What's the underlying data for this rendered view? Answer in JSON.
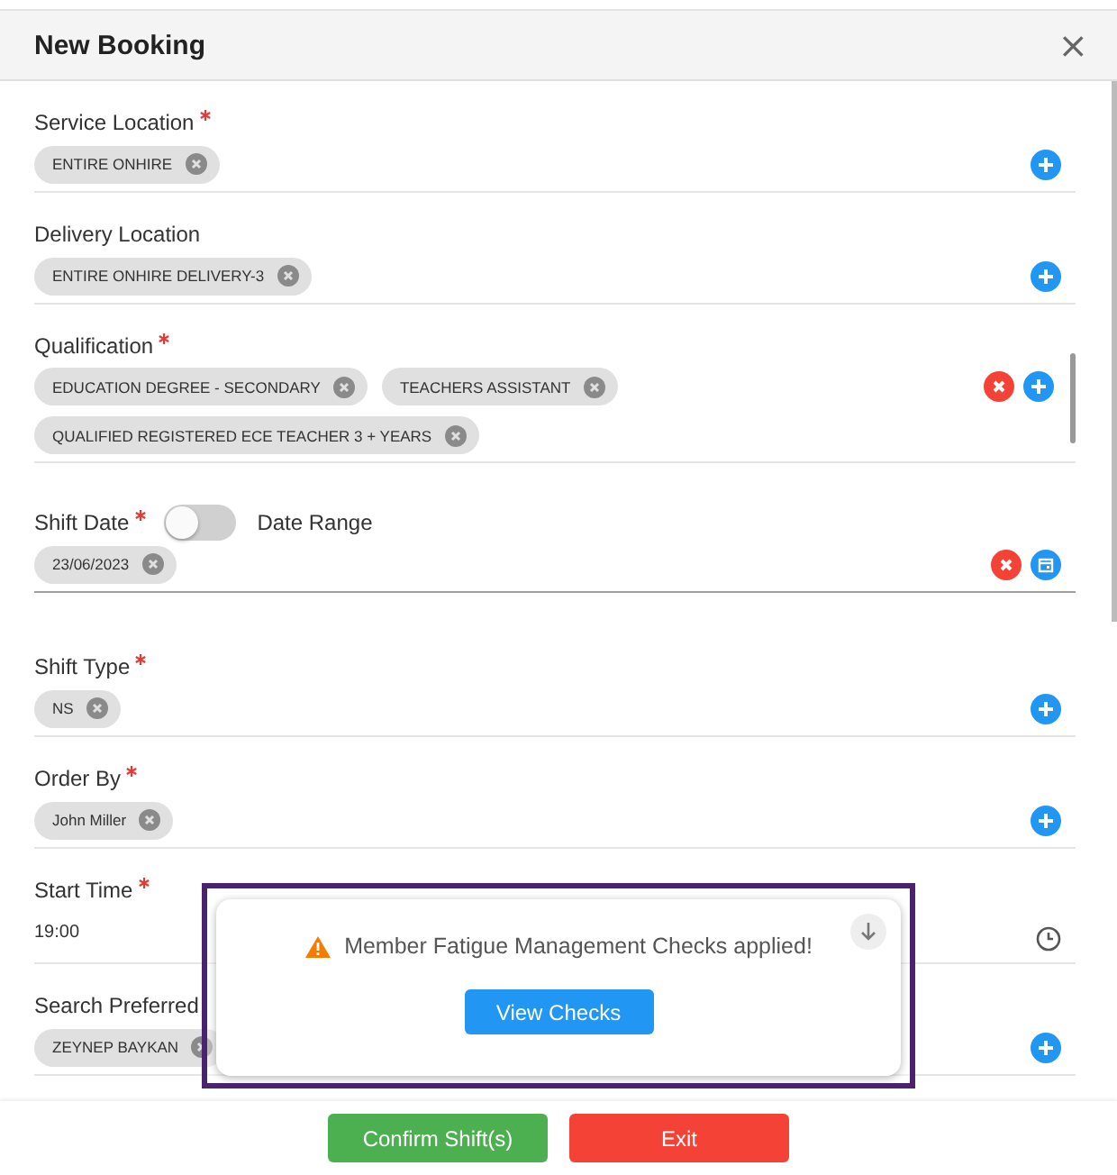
{
  "dialog": {
    "title": "New Booking",
    "close": "×"
  },
  "fields": [
    {
      "kind": "chips",
      "label": "Service Location",
      "required": true,
      "clearable": false,
      "chips": [
        "ENTIRE ONHIRE"
      ]
    },
    {
      "kind": "chips",
      "label": "Delivery Location",
      "required": false,
      "clearable": false,
      "chips": [
        "ENTIRE ONHIRE DELIVERY-3"
      ]
    },
    {
      "kind": "chips",
      "label": "Qualification",
      "required": true,
      "clearable": true,
      "chips": [
        "EDUCATION DEGREE - SECONDARY",
        "TEACHERS ASSISTANT",
        "QUALIFIED REGISTERED ECE TEACHER 3 + YEARS"
      ]
    },
    {
      "kind": "date",
      "label": "Shift Date",
      "required": true,
      "clearable": true,
      "toggle": {
        "label": "Date Range",
        "on": false
      },
      "chips": [
        "23/06/2023"
      ]
    },
    {
      "kind": "chips",
      "label": "Shift Type",
      "required": true,
      "clearable": false,
      "chips": [
        "NS"
      ]
    },
    {
      "kind": "chips",
      "label": "Order By",
      "required": true,
      "clearable": false,
      "chips": [
        "John Miller"
      ]
    },
    {
      "kind": "time",
      "label": "Start Time",
      "required": true,
      "clearable": false,
      "value": "19:00"
    },
    {
      "kind": "chips",
      "label": "Search Preferred",
      "required": false,
      "clearable": false,
      "chips": [
        "ZEYNEP BAYKAN"
      ]
    }
  ],
  "toast": {
    "message": "Member Fatigue Management Checks applied!",
    "button": "View Checks"
  },
  "footer": {
    "buttons": [
      {
        "label": "Confirm Shift(s)",
        "kind": "confirm"
      },
      {
        "label": "Exit",
        "kind": "exit"
      }
    ]
  }
}
